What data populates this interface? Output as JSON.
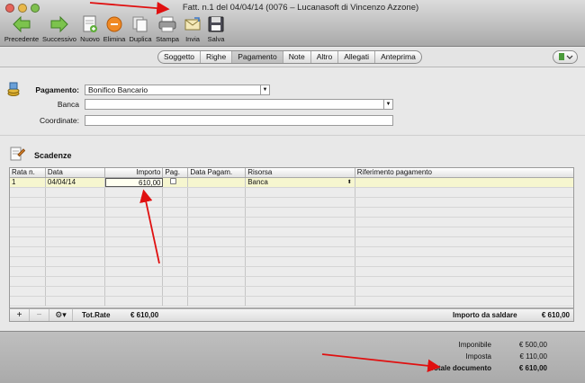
{
  "window": {
    "title": "Fatt. n.1 del 04/04/14 (0076 – Lucanasoft di Vincenzo Azzone)"
  },
  "toolbar": {
    "buttons": [
      {
        "label": "Precedente",
        "icon": "arrow-left-icon"
      },
      {
        "label": "Successivo",
        "icon": "arrow-right-icon"
      },
      {
        "label": "Nuovo",
        "icon": "new-document-icon"
      },
      {
        "label": "Elimina",
        "icon": "delete-icon"
      },
      {
        "label": "Duplica",
        "icon": "duplicate-icon"
      },
      {
        "label": "Stampa",
        "icon": "printer-icon"
      },
      {
        "label": "Invia",
        "icon": "send-mail-icon"
      },
      {
        "label": "Salva",
        "icon": "save-disk-icon"
      }
    ]
  },
  "tabs": {
    "items": [
      "Soggetto",
      "Righe",
      "Pagamento",
      "Note",
      "Altro",
      "Allegati",
      "Anteprima"
    ],
    "active": "Pagamento"
  },
  "payment": {
    "pagamento_label": "Pagamento:",
    "pagamento_value": "Bonifico Bancario",
    "banca_label": "Banca",
    "banca_value": "",
    "coordinate_label": "Coordinate:",
    "coordinate_value": ""
  },
  "scadenze": {
    "title": "Scadenze",
    "columns": [
      "Rata n.",
      "Data",
      "Importo",
      "Pag.",
      "Data Pagam.",
      "Risorsa",
      "Riferimento pagamento"
    ],
    "rows": [
      {
        "rata": "1",
        "data": "04/04/14",
        "importo": "610,00",
        "pag": false,
        "data_pagam": "",
        "risorsa": "Banca",
        "riferimento": ""
      }
    ],
    "footer": {
      "add": "+",
      "remove": "−",
      "tot_rate_label": "Tot.Rate",
      "tot_rate_value": "€ 610,00",
      "saldo_label": "Importo da saldare",
      "saldo_value": "€ 610,00"
    }
  },
  "totals": {
    "imponibile_label": "Imponibile",
    "imponibile_value": "€ 500,00",
    "imposta_label": "Imposta",
    "imposta_value": "€ 110,00",
    "totale_label": "Totale documento",
    "totale_value": "€ 610,00"
  },
  "colors": {
    "selected_row": "#f6f6cf",
    "annotation_red": "#e01010"
  }
}
